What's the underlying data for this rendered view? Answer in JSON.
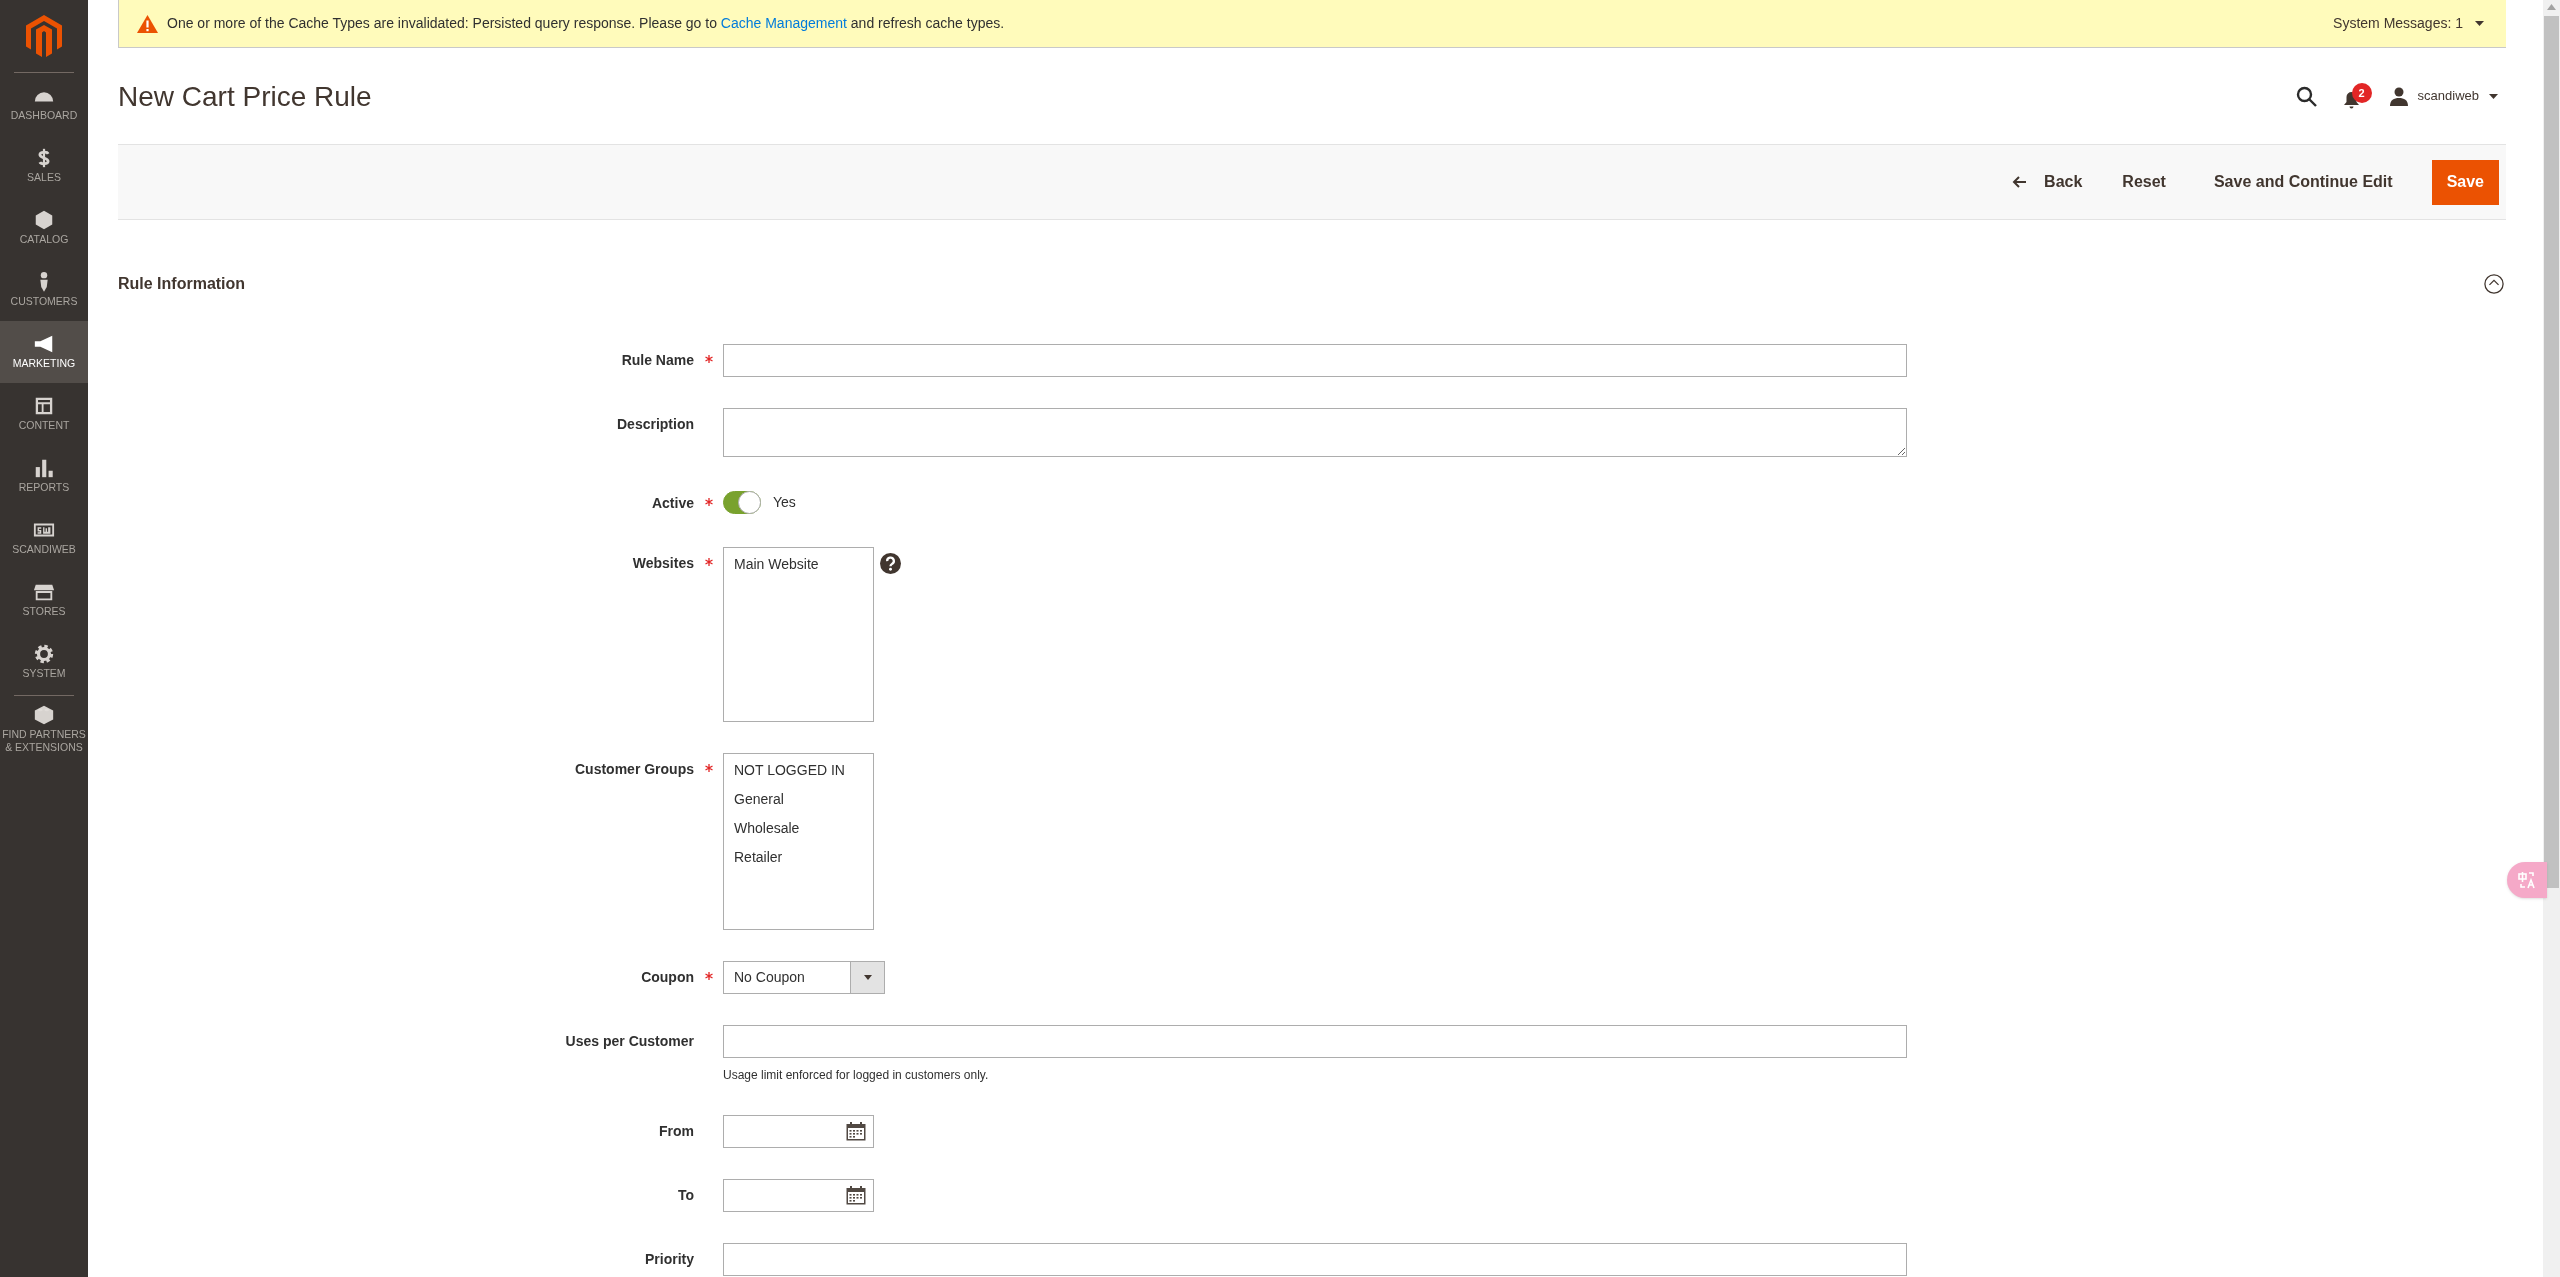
{
  "sidebar": {
    "items": [
      {
        "label": "DASHBOARD",
        "selected": false
      },
      {
        "label": "SALES",
        "selected": false
      },
      {
        "label": "CATALOG",
        "selected": false
      },
      {
        "label": "CUSTOMERS",
        "selected": false
      },
      {
        "label": "MARKETING",
        "selected": true
      },
      {
        "label": "CONTENT",
        "selected": false
      },
      {
        "label": "REPORTS",
        "selected": false
      },
      {
        "label": "SCANDIWEB",
        "selected": false
      },
      {
        "label": "STORES",
        "selected": false
      },
      {
        "label": "SYSTEM",
        "selected": false
      },
      {
        "label": "FIND PARTNERS & EXTENSIONS",
        "selected": false
      }
    ]
  },
  "system_message": {
    "text": "One or more of the Cache Types are invalidated: Persisted query response. Please go to ",
    "link": "Cache Management",
    "text_after": " and refresh cache types.",
    "count_label": "System Messages: 1"
  },
  "header": {
    "title": "New Cart Price Rule",
    "notifications": "2",
    "user": "scandiweb"
  },
  "actions": [
    {
      "label": "Back",
      "kind": "back"
    },
    {
      "label": "Reset",
      "kind": "plain"
    },
    {
      "label": "Save and Continue Edit",
      "kind": "plain"
    },
    {
      "label": "Save",
      "kind": "primary"
    }
  ],
  "section": {
    "title": "Rule Information",
    "expanded": true
  },
  "fields": [
    {
      "kind": "text",
      "label": "Rule Name",
      "required": true
    },
    {
      "kind": "textarea",
      "label": "Description",
      "required": false
    },
    {
      "kind": "toggle",
      "label": "Active",
      "required": true,
      "on": true,
      "value_label": "Yes"
    },
    {
      "kind": "multiselect",
      "label": "Websites",
      "required": true,
      "help": true,
      "options": [
        {
          "label": "Main Website",
          "selected": false
        }
      ]
    },
    {
      "kind": "multiselect",
      "label": "Customer Groups",
      "required": true,
      "help": false,
      "options": [
        {
          "label": "NOT LOGGED IN",
          "selected": false
        },
        {
          "label": "General",
          "selected": false
        },
        {
          "label": "Wholesale",
          "selected": false
        },
        {
          "label": "Retailer",
          "selected": false
        }
      ]
    },
    {
      "kind": "select",
      "label": "Coupon",
      "required": true,
      "value": "No Coupon"
    },
    {
      "kind": "text",
      "label": "Uses per Customer",
      "required": false,
      "note": "Usage limit enforced for logged in customers only."
    },
    {
      "kind": "date",
      "label": "From",
      "required": false
    },
    {
      "kind": "date",
      "label": "To",
      "required": false
    },
    {
      "kind": "text",
      "label": "Priority",
      "required": false
    }
  ]
}
